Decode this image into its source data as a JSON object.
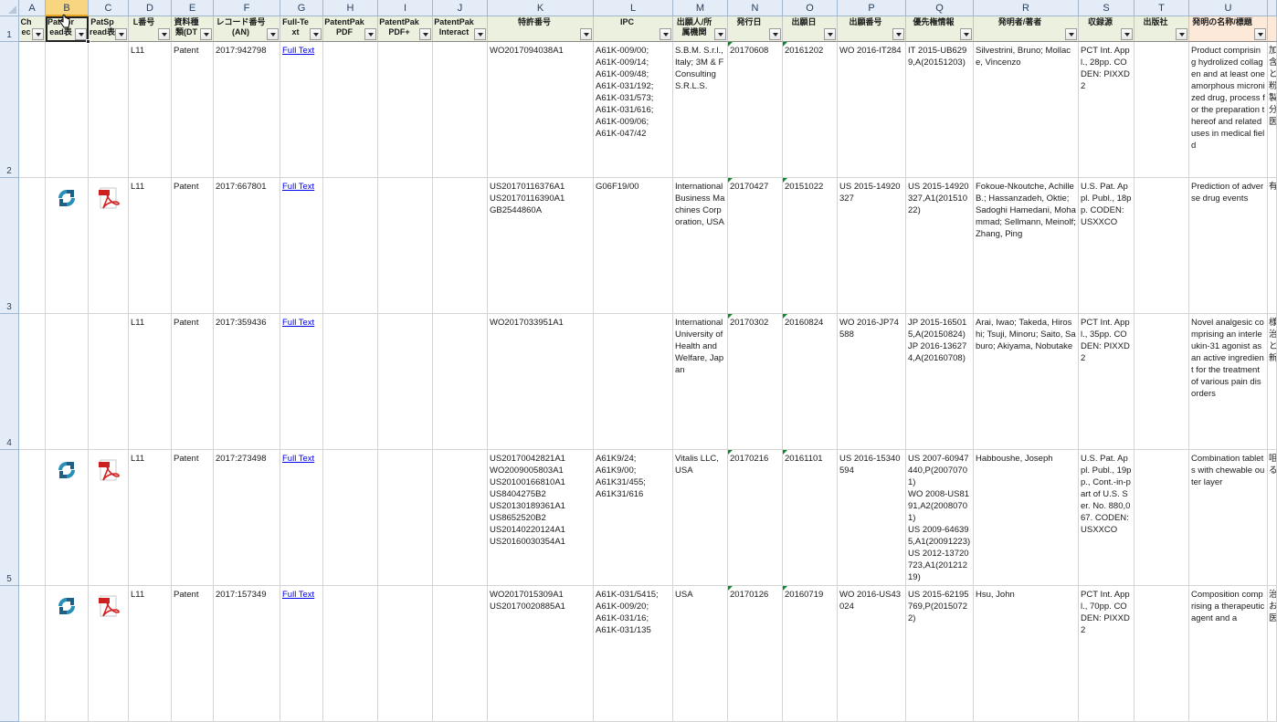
{
  "spreadsheet": {
    "columns": [
      {
        "letter": "A",
        "header": "Chec"
      },
      {
        "letter": "B",
        "header": "PatSpread表"
      },
      {
        "letter": "C",
        "header": "PatSpread表"
      },
      {
        "letter": "D",
        "header": "L番号"
      },
      {
        "letter": "E",
        "header": "資料種類(DT"
      },
      {
        "letter": "F",
        "header": "レコード番号(AN)"
      },
      {
        "letter": "G",
        "header": "Full-Text"
      },
      {
        "letter": "H",
        "header": "PatentPak PDF"
      },
      {
        "letter": "I",
        "header": "PatentPak PDF+"
      },
      {
        "letter": "J",
        "header": "PatentPak Interact"
      },
      {
        "letter": "K",
        "header": "特許番号"
      },
      {
        "letter": "L",
        "header": "IPC"
      },
      {
        "letter": "M",
        "header": "出願人/所属機関"
      },
      {
        "letter": "N",
        "header": "発行日"
      },
      {
        "letter": "O",
        "header": "出願日"
      },
      {
        "letter": "P",
        "header": "出願番号"
      },
      {
        "letter": "Q",
        "header": "優先権情報"
      },
      {
        "letter": "R",
        "header": "発明者/著者"
      },
      {
        "letter": "S",
        "header": "収録源"
      },
      {
        "letter": "T",
        "header": "出版社"
      },
      {
        "letter": "U",
        "header": "発明の名称/標題"
      }
    ],
    "row_numbers": [
      "1",
      "2",
      "3",
      "4",
      "5"
    ],
    "rows": [
      {
        "has_icons": false,
        "cells": [
          "",
          "",
          "",
          "L11",
          "Patent",
          "2017:942798",
          "Full Text",
          "",
          "",
          "",
          "WO2017094038A1",
          "A61K-009/00;\nA61K-009/14;\nA61K-009/48;\nA61K-031/192;\nA61K-031/573;\nA61K-031/616;\nA61K-009/06;\nA61K-047/42",
          "S.B.M. S.r.l., Italy; 3M & F Consulting S.R.L.S.",
          "20170608",
          "20161202",
          "WO 2016-IT284",
          "IT 2015-UB6299,A(20151203)",
          "Silvestrini, Bruno; Mollace, Vincenzo",
          "PCT Int. Appl., 28pp. CODEN: PIXXD2",
          "",
          "Product comprising hydrolized collagen and at least one amorphous micronized drug, process for the preparation thereof and related uses in medical field"
        ]
      },
      {
        "has_icons": true,
        "cells": [
          "",
          "",
          "",
          "L11",
          "Patent",
          "2017:667801",
          "Full Text",
          "",
          "",
          "",
          "US20170116376A1\nUS20170116390A1\nGB2544860A",
          "G06F19/00",
          "International Business Machines Corporation, USA",
          "20170427",
          "20151022",
          "US 2015-14920327",
          "US 2015-14920327,A1(20151022)",
          "Fokoue-Nkoutche, Achille B.; Hassanzadeh, Oktie; Sadoghi Hamedani, Mohammad; Sellmann, Meinolf; Zhang, Ping",
          "U.S. Pat. Appl. Publ., 18pp. CODEN: USXXCO",
          "",
          "Prediction of adverse drug events"
        ]
      },
      {
        "has_icons": false,
        "cells": [
          "",
          "",
          "",
          "L11",
          "Patent",
          "2017:359436",
          "Full Text",
          "",
          "",
          "",
          "WO2017033951A1",
          "",
          "International University of Health and Welfare, Japan",
          "20170302",
          "20160824",
          "WO 2016-JP74588",
          "JP 2015-165015,A(20150824)\nJP 2016-136274,A(20160708)",
          "Arai, Iwao; Takeda, Hiroshi; Tsuji, Minoru; Saito, Saburo; Akiyama, Nobutake",
          "PCT Int. Appl., 35pp. CODEN: PIXXD2",
          "",
          "Novel analgesic comprising an interleukin-31 agonist as an active ingredient for the treatment of various pain disorders"
        ]
      },
      {
        "has_icons": true,
        "cells": [
          "",
          "",
          "",
          "L11",
          "Patent",
          "2017:273498",
          "Full Text",
          "",
          "",
          "",
          "US20170042821A1\nWO2009005803A1\nUS20100166810A1\nUS8404275B2\nUS20130189361A1\nUS8652520B2\nUS20140220124A1\nUS20160030354A1",
          "A61K9/24;\nA61K9/00;\nA61K31/455;\nA61K31/616",
          "Vitalis LLC, USA",
          "20170216",
          "20161101",
          "US 2016-15340594",
          "US 2007-60947440,P(20070701)\nWO 2008-US8191,A2(20080701)\nUS 2009-646395,A1(20091223)\nUS 2012-13720723,A1(20121219)",
          "Habboushe, Joseph",
          "U.S. Pat. Appl. Publ., 19pp., Cont.-in-part of U.S. Ser. No. 880,067. CODEN: USXXCO",
          "",
          "Combination tablets with chewable outer layer"
        ]
      },
      {
        "has_icons": true,
        "cells": [
          "",
          "",
          "",
          "L11",
          "Patent",
          "2017:157349",
          "Full Text",
          "",
          "",
          "",
          "WO2017015309A1\nUS20170020885A1",
          "A61K-031/5415;\nA61K-009/20;\nA61K-031/16;\nA61K-031/135",
          "USA",
          "20170126",
          "20160719",
          "WO 2016-US43024",
          "US 2015-62195769,P(20150722)",
          "Hsu, John",
          "PCT Int. Appl., 70pp. CODEN: PIXXD2",
          "",
          "Composition comprising a therapeutic agent and a"
        ]
      }
    ],
    "overflow_column_V": [
      "加\n含\nと\n粉\n製\n分\n医",
      "有",
      "様\n治\nと\n新",
      "咀\nる",
      "治\nお\n医"
    ]
  },
  "colors": {
    "header_green": "#ebf1de",
    "header_pink": "#fde9d9",
    "link_blue": "#0000ee",
    "active_header": "#f8d580",
    "grid_line": "#d4d4d4"
  },
  "icons": {
    "patspread_logo": "patspread-logo-icon",
    "pdf": "pdf-icon",
    "filter_dropdown": "filter-dropdown-icon",
    "cursor": "move-cursor-icon"
  }
}
